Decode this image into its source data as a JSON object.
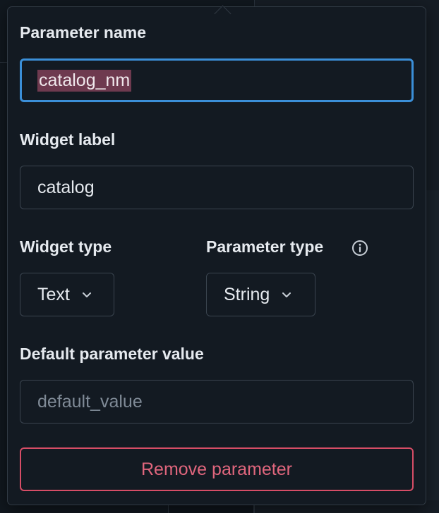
{
  "form": {
    "parameter_name": {
      "label": "Parameter name",
      "value": "catalog_nm"
    },
    "widget_label": {
      "label": "Widget label",
      "value": "catalog"
    },
    "widget_type": {
      "label": "Widget type",
      "selected": "Text"
    },
    "parameter_type": {
      "label": "Parameter type",
      "selected": "String",
      "info_icon": "info-circle-icon"
    },
    "default_value": {
      "label": "Default parameter value",
      "placeholder": "default_value"
    },
    "remove_label": "Remove parameter"
  },
  "colors": {
    "focus_border": "#3b8fd8",
    "danger": "#d64d66",
    "selection": "#6e3a4f"
  }
}
